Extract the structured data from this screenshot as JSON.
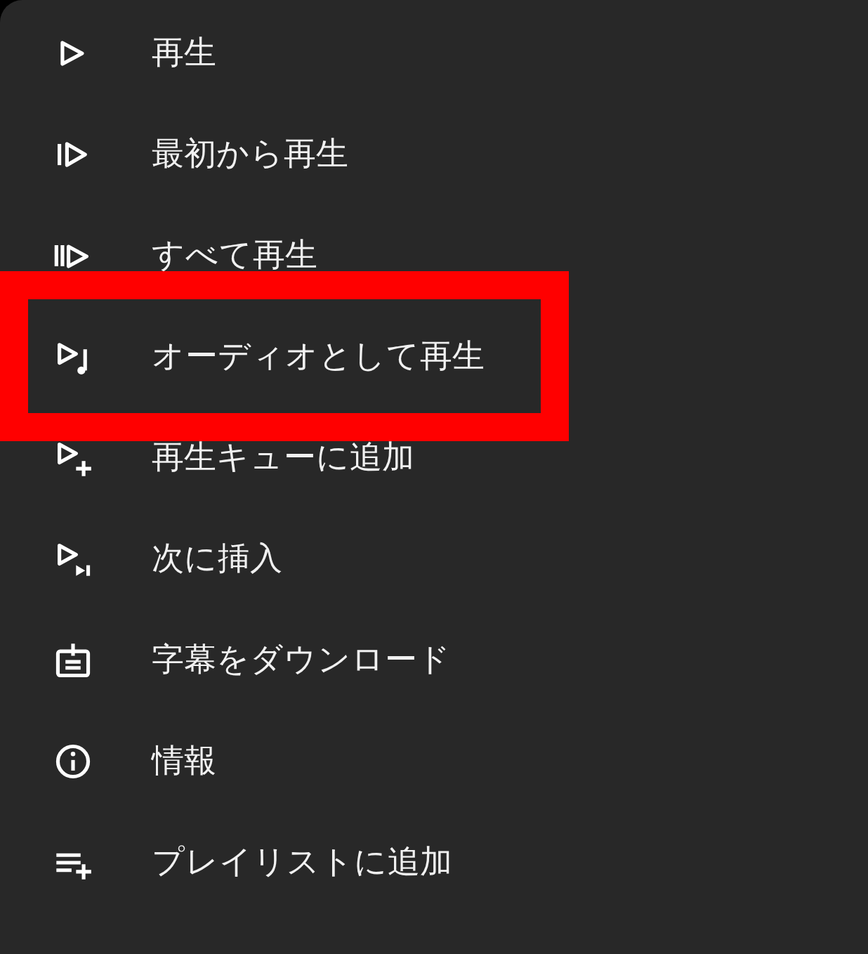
{
  "menu": {
    "items": [
      {
        "kind": "play",
        "label": "再生",
        "highlighted": false
      },
      {
        "kind": "play-start",
        "label": "最初から再生",
        "highlighted": false
      },
      {
        "kind": "play-all",
        "label": "すべて再生",
        "highlighted": false
      },
      {
        "kind": "play-audio",
        "label": "オーディオとして再生",
        "highlighted": true
      },
      {
        "kind": "queue-add",
        "label": "再生キューに追加",
        "highlighted": false
      },
      {
        "kind": "play-next",
        "label": "次に挿入",
        "highlighted": false
      },
      {
        "kind": "subtitles",
        "label": "字幕をダウンロード",
        "highlighted": false
      },
      {
        "kind": "info",
        "label": "情報",
        "highlighted": false
      },
      {
        "kind": "playlist-add",
        "label": "プレイリストに追加",
        "highlighted": false
      }
    ]
  }
}
